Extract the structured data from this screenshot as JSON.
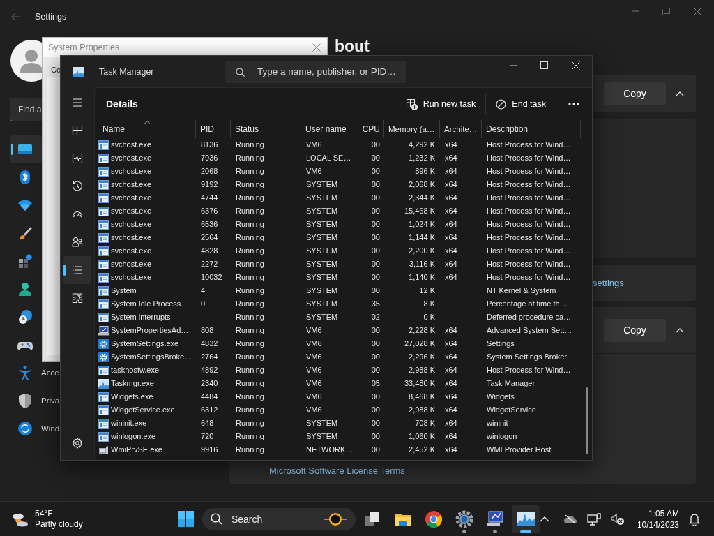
{
  "settings": {
    "title": "Settings",
    "search": {
      "placeholder": "Find a"
    },
    "heading": "bout",
    "sidebar": [
      {
        "kind": "display",
        "selected": true
      },
      {
        "kind": "bluetooth",
        "selected": false
      },
      {
        "kind": "network",
        "selected": false
      },
      {
        "kind": "personalization",
        "selected": false
      },
      {
        "kind": "apps",
        "selected": false
      },
      {
        "kind": "accounts",
        "selected": false
      },
      {
        "kind": "time",
        "selected": false
      },
      {
        "kind": "gaming",
        "selected": false
      },
      {
        "kind": "accessibility",
        "label": "Acce",
        "selected": false
      },
      {
        "kind": "privacy",
        "label": "Priva",
        "selected": false
      },
      {
        "kind": "update",
        "label": "Wind",
        "selected": false
      }
    ],
    "cards": [
      {
        "kind": "copy",
        "button": "Copy",
        "expanded": true
      },
      {
        "kind": "blank"
      },
      {
        "kind": "link",
        "link": "settings"
      },
      {
        "kind": "copy_footer",
        "button": "Copy",
        "expanded": true,
        "link": "Microsoft Software License Terms"
      }
    ]
  },
  "system_properties": {
    "title": "System Properties",
    "tab": "Co"
  },
  "task_manager": {
    "title": "Task Manager",
    "search": {
      "placeholder": "Type a name, publisher, or PID…"
    },
    "nav": [
      {
        "kind": "menu",
        "selected": false
      },
      {
        "kind": "processes",
        "selected": false
      },
      {
        "kind": "performance",
        "selected": false
      },
      {
        "kind": "history",
        "selected": false
      },
      {
        "kind": "startup",
        "selected": false
      },
      {
        "kind": "users",
        "selected": false
      },
      {
        "kind": "details",
        "selected": true
      },
      {
        "kind": "services",
        "selected": false
      },
      {
        "kind": "settings",
        "selected": false
      }
    ],
    "page": "Details",
    "actions": [
      {
        "kind": "run",
        "label": "Run new task"
      },
      {
        "kind": "end",
        "label": "End task"
      },
      {
        "kind": "more"
      }
    ],
    "columns": [
      {
        "label": "Name",
        "sorted": true
      },
      {
        "label": "PID",
        "sorted": false
      },
      {
        "label": "Status",
        "sorted": false
      },
      {
        "label": "User name",
        "sorted": false
      },
      {
        "label": "CPU",
        "sorted": false
      },
      {
        "label": "Memory (a…",
        "sorted": false
      },
      {
        "label": "Archite…",
        "sorted": false
      },
      {
        "label": "Description",
        "sorted": false
      }
    ],
    "rows": [
      {
        "kind": "service",
        "name": "svchost.exe",
        "pid": "8136",
        "status": "Running",
        "user": "VM6",
        "cpu": "00",
        "memory": "4,292 K",
        "arch": "x64",
        "description": "Host Process for Wind…"
      },
      {
        "kind": "service",
        "name": "svchost.exe",
        "pid": "7936",
        "status": "Running",
        "user": "LOCAL SE…",
        "cpu": "00",
        "memory": "1,232 K",
        "arch": "x64",
        "description": "Host Process for Wind…"
      },
      {
        "kind": "service",
        "name": "svchost.exe",
        "pid": "2068",
        "status": "Running",
        "user": "VM6",
        "cpu": "00",
        "memory": "896 K",
        "arch": "x64",
        "description": "Host Process for Wind…"
      },
      {
        "kind": "service",
        "name": "svchost.exe",
        "pid": "9192",
        "status": "Running",
        "user": "SYSTEM",
        "cpu": "00",
        "memory": "2,068 K",
        "arch": "x64",
        "description": "Host Process for Wind…"
      },
      {
        "kind": "service",
        "name": "svchost.exe",
        "pid": "4744",
        "status": "Running",
        "user": "SYSTEM",
        "cpu": "00",
        "memory": "2,344 K",
        "arch": "x64",
        "description": "Host Process for Wind…"
      },
      {
        "kind": "service",
        "name": "svchost.exe",
        "pid": "6376",
        "status": "Running",
        "user": "SYSTEM",
        "cpu": "00",
        "memory": "15,468 K",
        "arch": "x64",
        "description": "Host Process for Wind…"
      },
      {
        "kind": "service",
        "name": "svchost.exe",
        "pid": "6536",
        "status": "Running",
        "user": "SYSTEM",
        "cpu": "00",
        "memory": "1,024 K",
        "arch": "x64",
        "description": "Host Process for Wind…"
      },
      {
        "kind": "service",
        "name": "svchost.exe",
        "pid": "2564",
        "status": "Running",
        "user": "SYSTEM",
        "cpu": "00",
        "memory": "1,144 K",
        "arch": "x64",
        "description": "Host Process for Wind…"
      },
      {
        "kind": "service",
        "name": "svchost.exe",
        "pid": "4828",
        "status": "Running",
        "user": "SYSTEM",
        "cpu": "00",
        "memory": "2,200 K",
        "arch": "x64",
        "description": "Host Process for Wind…"
      },
      {
        "kind": "service",
        "name": "svchost.exe",
        "pid": "2272",
        "status": "Running",
        "user": "SYSTEM",
        "cpu": "00",
        "memory": "3,116 K",
        "arch": "x64",
        "description": "Host Process for Wind…"
      },
      {
        "kind": "service",
        "name": "svchost.exe",
        "pid": "10032",
        "status": "Running",
        "user": "SYSTEM",
        "cpu": "00",
        "memory": "1,140 K",
        "arch": "x64",
        "description": "Host Process for Wind…"
      },
      {
        "kind": "service",
        "name": "System",
        "pid": "4",
        "status": "Running",
        "user": "SYSTEM",
        "cpu": "00",
        "memory": "12 K",
        "description": "NT Kernel & System"
      },
      {
        "kind": "service",
        "name": "System Idle Process",
        "pid": "0",
        "status": "Running",
        "user": "SYSTEM",
        "cpu": "35",
        "memory": "8 K",
        "description": "Percentage of time th…"
      },
      {
        "kind": "service",
        "name": "System interrupts",
        "pid": "-",
        "status": "Running",
        "user": "SYSTEM",
        "cpu": "02",
        "memory": "0 K",
        "description": "Deferred procedure ca…"
      },
      {
        "kind": "sysprops",
        "name": "SystemPropertiesAd…",
        "pid": "808",
        "status": "Running",
        "user": "VM6",
        "cpu": "00",
        "memory": "2,228 K",
        "arch": "x64",
        "description": "Advanced System Sett…"
      },
      {
        "kind": "gear",
        "name": "SystemSettings.exe",
        "pid": "4832",
        "status": "Running",
        "user": "VM6",
        "cpu": "00",
        "memory": "27,028 K",
        "arch": "x64",
        "description": "Settings"
      },
      {
        "kind": "gear",
        "name": "SystemSettingsBroke…",
        "pid": "2764",
        "status": "Running",
        "user": "VM6",
        "cpu": "00",
        "memory": "2,296 K",
        "arch": "x64",
        "description": "System Settings Broker"
      },
      {
        "kind": "service",
        "name": "taskhostw.exe",
        "pid": "4892",
        "status": "Running",
        "user": "VM6",
        "cpu": "00",
        "memory": "2,988 K",
        "arch": "x64",
        "description": "Host Process for Wind…"
      },
      {
        "kind": "taskmgr",
        "name": "Taskmgr.exe",
        "pid": "2340",
        "status": "Running",
        "user": "VM6",
        "cpu": "05",
        "memory": "33,480 K",
        "arch": "x64",
        "description": "Task Manager"
      },
      {
        "kind": "service",
        "name": "Widgets.exe",
        "pid": "4484",
        "status": "Running",
        "user": "VM6",
        "cpu": "00",
        "memory": "8,468 K",
        "arch": "x64",
        "description": "Widgets"
      },
      {
        "kind": "service",
        "name": "WidgetService.exe",
        "pid": "6312",
        "status": "Running",
        "user": "VM6",
        "cpu": "00",
        "memory": "2,988 K",
        "arch": "x64",
        "description": "WidgetService"
      },
      {
        "kind": "service",
        "name": "wininit.exe",
        "pid": "648",
        "status": "Running",
        "user": "SYSTEM",
        "cpu": "00",
        "memory": "708 K",
        "arch": "x64",
        "description": "wininit"
      },
      {
        "kind": "service",
        "name": "winlogon.exe",
        "pid": "720",
        "status": "Running",
        "user": "SYSTEM",
        "cpu": "00",
        "memory": "1,060 K",
        "arch": "x64",
        "description": "winlogon"
      },
      {
        "kind": "wmi",
        "name": "WmiPrvSE.exe",
        "pid": "9916",
        "status": "Running",
        "user": "NETWORK…",
        "cpu": "00",
        "memory": "2,452 K",
        "arch": "x64",
        "description": "WMI Provider Host"
      }
    ]
  },
  "taskbar": {
    "temperature": "54°F",
    "condition": "Partly cloudy",
    "search": "Search",
    "apps": [
      {
        "kind": "taskview",
        "running": false,
        "selected": false
      },
      {
        "kind": "explorer",
        "running": false,
        "selected": false
      },
      {
        "kind": "chrome",
        "running": false,
        "selected": false
      },
      {
        "kind": "settings",
        "running": true,
        "selected": false
      },
      {
        "kind": "sysprops",
        "running": true,
        "selected": false
      },
      {
        "kind": "taskmgr",
        "running": true,
        "selected": true
      }
    ],
    "time": "1:05 AM",
    "date": "10/14/2023"
  }
}
